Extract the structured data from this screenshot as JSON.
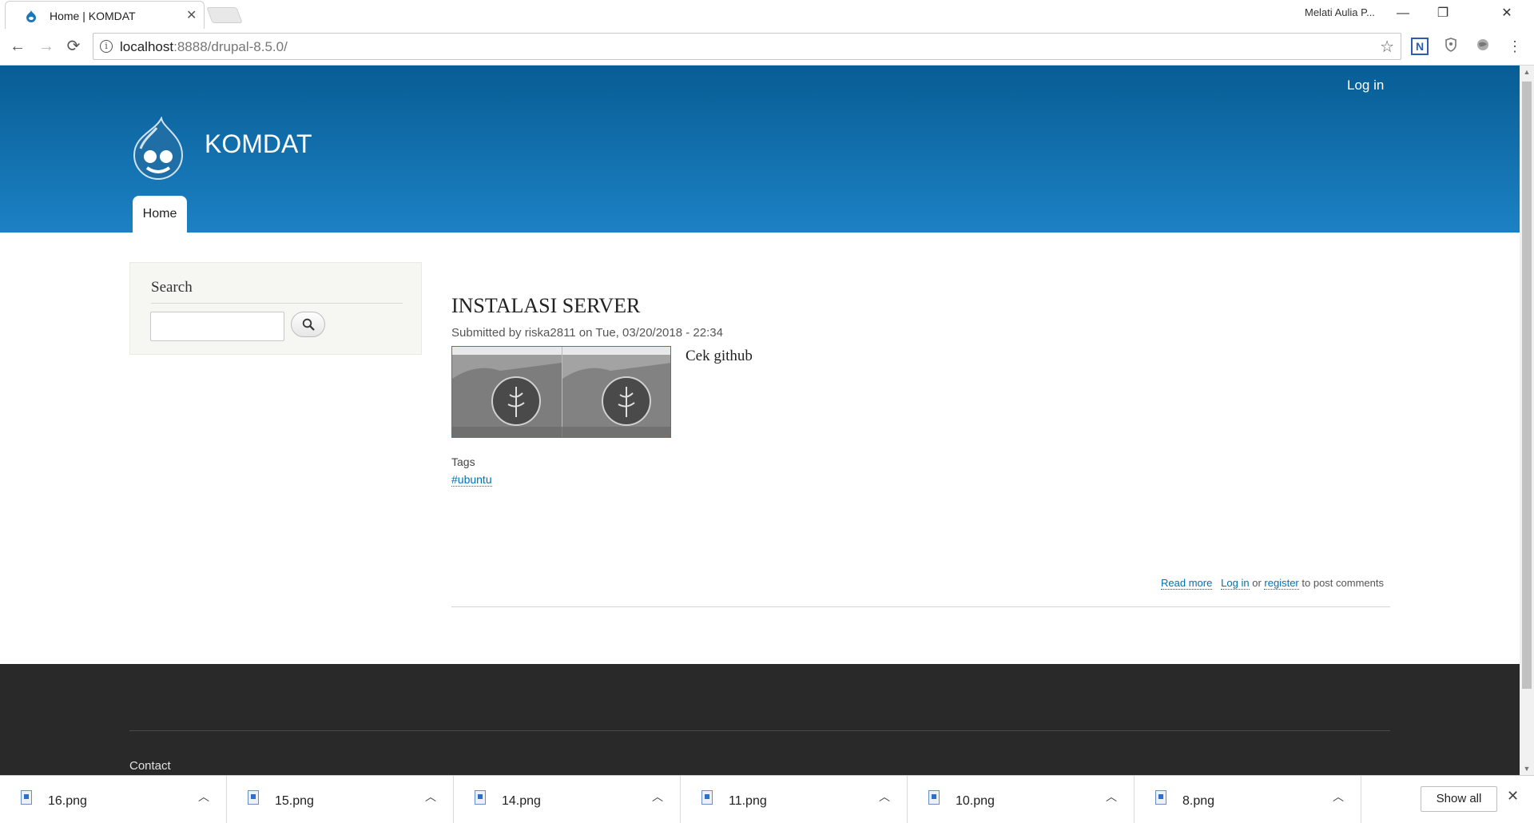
{
  "browser": {
    "tab_title": "Home | KOMDAT",
    "tab_close": "✕",
    "profile_name": "Melati Aulia P...",
    "url_host": "localhost",
    "url_path": ":8888/drupal-8.5.0/",
    "window_controls": {
      "minimize": "—",
      "restore": "❐",
      "close": "✕"
    },
    "nav": {
      "back": "←",
      "forward": "→",
      "reload": "⟳"
    },
    "extension_label": "N"
  },
  "header": {
    "login_label": "Log in",
    "site_name": "KOMDAT",
    "home_tab": "Home",
    "brand_color": "#1a78bd"
  },
  "sidebar": {
    "search_title": "Search",
    "search_value": ""
  },
  "article": {
    "title": "INSTALASI SERVER",
    "submitted": "Submitted by riska2811 on Tue, 03/20/2018 - 22:34",
    "body": "Cek github",
    "tags_label": "Tags",
    "tag": "#ubuntu",
    "read_more": "Read more",
    "log_in": "Log in",
    "or_text": "or",
    "register": "register",
    "post_comments_text": "to post comments"
  },
  "footer": {
    "contact": "Contact"
  },
  "downloads": {
    "items": [
      "16.png",
      "15.png",
      "14.png",
      "11.png",
      "10.png",
      "8.png"
    ],
    "show_all": "Show all",
    "close": "✕",
    "chevron": "^"
  }
}
